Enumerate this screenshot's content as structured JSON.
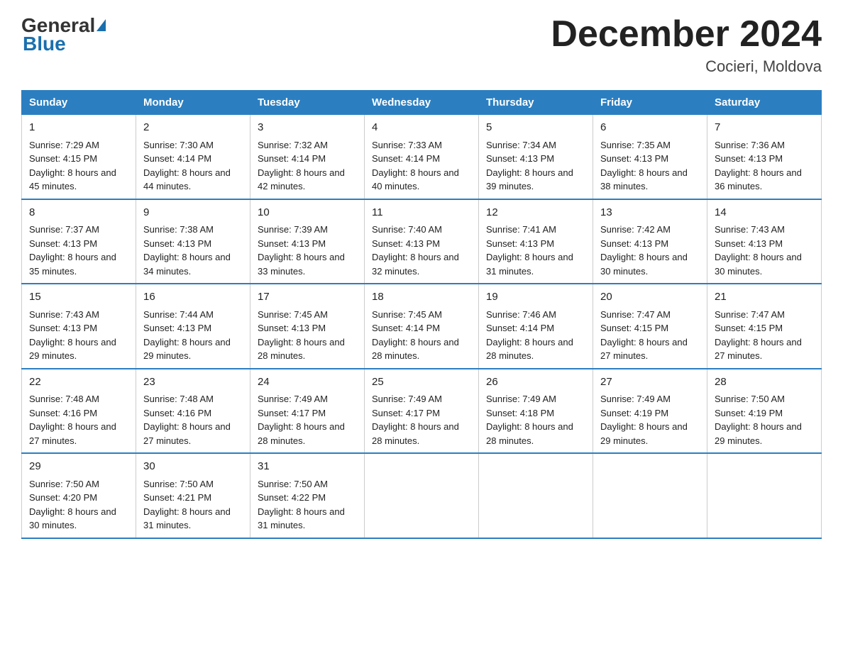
{
  "logo": {
    "general": "General",
    "blue": "Blue"
  },
  "title": "December 2024",
  "location": "Cocieri, Moldova",
  "days_of_week": [
    "Sunday",
    "Monday",
    "Tuesday",
    "Wednesday",
    "Thursday",
    "Friday",
    "Saturday"
  ],
  "weeks": [
    [
      {
        "day": "1",
        "sunrise": "7:29 AM",
        "sunset": "4:15 PM",
        "daylight": "8 hours and 45 minutes."
      },
      {
        "day": "2",
        "sunrise": "7:30 AM",
        "sunset": "4:14 PM",
        "daylight": "8 hours and 44 minutes."
      },
      {
        "day": "3",
        "sunrise": "7:32 AM",
        "sunset": "4:14 PM",
        "daylight": "8 hours and 42 minutes."
      },
      {
        "day": "4",
        "sunrise": "7:33 AM",
        "sunset": "4:14 PM",
        "daylight": "8 hours and 40 minutes."
      },
      {
        "day": "5",
        "sunrise": "7:34 AM",
        "sunset": "4:13 PM",
        "daylight": "8 hours and 39 minutes."
      },
      {
        "day": "6",
        "sunrise": "7:35 AM",
        "sunset": "4:13 PM",
        "daylight": "8 hours and 38 minutes."
      },
      {
        "day": "7",
        "sunrise": "7:36 AM",
        "sunset": "4:13 PM",
        "daylight": "8 hours and 36 minutes."
      }
    ],
    [
      {
        "day": "8",
        "sunrise": "7:37 AM",
        "sunset": "4:13 PM",
        "daylight": "8 hours and 35 minutes."
      },
      {
        "day": "9",
        "sunrise": "7:38 AM",
        "sunset": "4:13 PM",
        "daylight": "8 hours and 34 minutes."
      },
      {
        "day": "10",
        "sunrise": "7:39 AM",
        "sunset": "4:13 PM",
        "daylight": "8 hours and 33 minutes."
      },
      {
        "day": "11",
        "sunrise": "7:40 AM",
        "sunset": "4:13 PM",
        "daylight": "8 hours and 32 minutes."
      },
      {
        "day": "12",
        "sunrise": "7:41 AM",
        "sunset": "4:13 PM",
        "daylight": "8 hours and 31 minutes."
      },
      {
        "day": "13",
        "sunrise": "7:42 AM",
        "sunset": "4:13 PM",
        "daylight": "8 hours and 30 minutes."
      },
      {
        "day": "14",
        "sunrise": "7:43 AM",
        "sunset": "4:13 PM",
        "daylight": "8 hours and 30 minutes."
      }
    ],
    [
      {
        "day": "15",
        "sunrise": "7:43 AM",
        "sunset": "4:13 PM",
        "daylight": "8 hours and 29 minutes."
      },
      {
        "day": "16",
        "sunrise": "7:44 AM",
        "sunset": "4:13 PM",
        "daylight": "8 hours and 29 minutes."
      },
      {
        "day": "17",
        "sunrise": "7:45 AM",
        "sunset": "4:13 PM",
        "daylight": "8 hours and 28 minutes."
      },
      {
        "day": "18",
        "sunrise": "7:45 AM",
        "sunset": "4:14 PM",
        "daylight": "8 hours and 28 minutes."
      },
      {
        "day": "19",
        "sunrise": "7:46 AM",
        "sunset": "4:14 PM",
        "daylight": "8 hours and 28 minutes."
      },
      {
        "day": "20",
        "sunrise": "7:47 AM",
        "sunset": "4:15 PM",
        "daylight": "8 hours and 27 minutes."
      },
      {
        "day": "21",
        "sunrise": "7:47 AM",
        "sunset": "4:15 PM",
        "daylight": "8 hours and 27 minutes."
      }
    ],
    [
      {
        "day": "22",
        "sunrise": "7:48 AM",
        "sunset": "4:16 PM",
        "daylight": "8 hours and 27 minutes."
      },
      {
        "day": "23",
        "sunrise": "7:48 AM",
        "sunset": "4:16 PM",
        "daylight": "8 hours and 27 minutes."
      },
      {
        "day": "24",
        "sunrise": "7:49 AM",
        "sunset": "4:17 PM",
        "daylight": "8 hours and 28 minutes."
      },
      {
        "day": "25",
        "sunrise": "7:49 AM",
        "sunset": "4:17 PM",
        "daylight": "8 hours and 28 minutes."
      },
      {
        "day": "26",
        "sunrise": "7:49 AM",
        "sunset": "4:18 PM",
        "daylight": "8 hours and 28 minutes."
      },
      {
        "day": "27",
        "sunrise": "7:49 AM",
        "sunset": "4:19 PM",
        "daylight": "8 hours and 29 minutes."
      },
      {
        "day": "28",
        "sunrise": "7:50 AM",
        "sunset": "4:19 PM",
        "daylight": "8 hours and 29 minutes."
      }
    ],
    [
      {
        "day": "29",
        "sunrise": "7:50 AM",
        "sunset": "4:20 PM",
        "daylight": "8 hours and 30 minutes."
      },
      {
        "day": "30",
        "sunrise": "7:50 AM",
        "sunset": "4:21 PM",
        "daylight": "8 hours and 31 minutes."
      },
      {
        "day": "31",
        "sunrise": "7:50 AM",
        "sunset": "4:22 PM",
        "daylight": "8 hours and 31 minutes."
      },
      null,
      null,
      null,
      null
    ]
  ],
  "labels": {
    "sunrise": "Sunrise:",
    "sunset": "Sunset:",
    "daylight": "Daylight:"
  }
}
